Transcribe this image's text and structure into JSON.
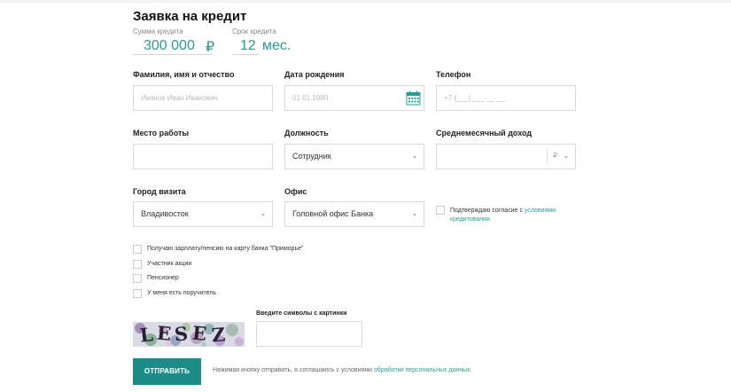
{
  "form": {
    "title": "Заявка на кредит",
    "amount": {
      "label": "Сумма кредита",
      "value": "300 000",
      "currency": "₽"
    },
    "term": {
      "label": "Срок кредита",
      "value": "12",
      "unit": "мес."
    }
  },
  "fields": {
    "fio": {
      "label": "Фамилия, имя и отчество",
      "placeholder": "Иванов Иван Иванович"
    },
    "birth": {
      "label": "Дата рождения",
      "placeholder": "01.01.1990"
    },
    "phone": {
      "label": "Телефон",
      "placeholder": "+7 (___) ___-__-__"
    },
    "work": {
      "label": "Место работы",
      "value": ""
    },
    "position": {
      "label": "Должность",
      "value": "Сотрудник"
    },
    "income": {
      "label": "Среднемесячный доход",
      "currency": "₽"
    },
    "city": {
      "label": "Город визита",
      "value": "Владивосток"
    },
    "office": {
      "label": "Офис",
      "value": "Головной офис Банка"
    }
  },
  "consent": {
    "text": "Подтверждаю согласие с",
    "link1": "условиями",
    "link2": "кредитования"
  },
  "checkboxes": [
    "Получаю зарплату/пенсию на карту банка \"Приморье\"",
    "Участник акции",
    "Пенсионер",
    "У меня есть поручитель"
  ],
  "captcha": {
    "label": "Введите символы с картинки",
    "text": "LESEZ",
    "value": ""
  },
  "submit": {
    "button": "ОТПРАВИТЬ",
    "note": "Нажимая кнопку отправить, я соглашаюсь с условиями",
    "link": "обработки персональных данных."
  },
  "colors": {
    "accent": "#1c8c86",
    "link": "#2a9b95"
  }
}
